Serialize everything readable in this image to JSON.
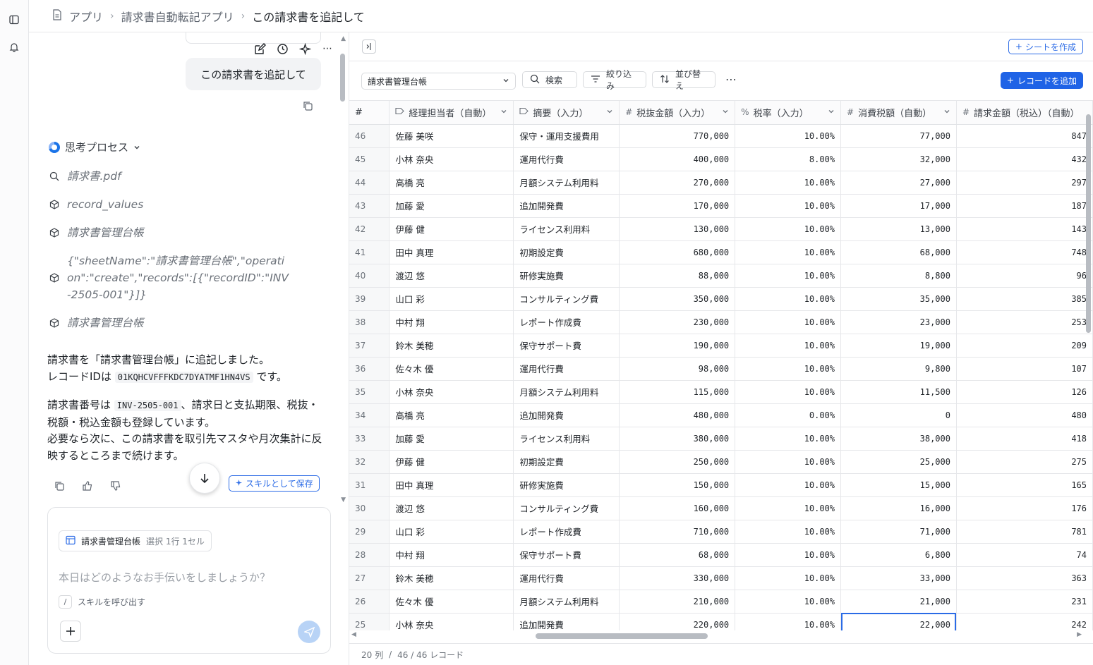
{
  "breadcrumb": {
    "items": [
      "アプリ",
      "請求書自動転記アプリ",
      "この請求書を追記して"
    ]
  },
  "chat": {
    "user_message": "この請求書を追記して",
    "thinking_label": "思考プロセス",
    "steps": [
      {
        "icon": "search-icon",
        "text": "請求書.pdf"
      },
      {
        "icon": "cube-icon",
        "text": "record_values"
      },
      {
        "icon": "cube-icon",
        "text": "請求書管理台帳"
      },
      {
        "icon": "cube-icon",
        "text": "{\"sheetName\":\"請求書管理台帳\",\"operation\":\"create\",\"records\":[{\"recordID\":\"INV-2505-001\"}]}"
      },
      {
        "icon": "cube-icon",
        "text": "請求書管理台帳"
      }
    ],
    "answer": {
      "p1_line1": "請求書を「請求書管理台帳」に追記しました。",
      "p1_prefix": "レコードIDは",
      "record_id": "01KQHCVFFFKDC7DYATMF1HN4VS",
      "p1_suffix": "です。",
      "p2_prefix": "請求書番号は",
      "invoice_no": "INV-2505-001",
      "p2_suffix": "、請求日と支払期限、税抜・税額・税込金額も登録しています。",
      "p3": "必要なら次に、この請求書を取引先マスタや月次集計に反映するところまで続けます。"
    },
    "save_skill_label": "スキルとして保存",
    "composer": {
      "context_sheet": "請求書管理台帳",
      "context_selection": "選択 1行 1セル",
      "placeholder": "本日はどのようなお手伝いをしましょうか？",
      "slash_key": "/",
      "slash_hint": "スキルを呼び出す"
    }
  },
  "sheet": {
    "create_sheet_label": "シートを作成",
    "selected_sheet": "請求書管理台帳",
    "search_label": "検索",
    "filter_label": "絞り込み",
    "sort_label": "並び替え",
    "add_record_label": "レコードを追加",
    "columns": [
      {
        "label": "#",
        "type": ""
      },
      {
        "label": "経理担当者（自動）",
        "type": "tag"
      },
      {
        "label": "摘要（入力）",
        "type": "tag"
      },
      {
        "label": "税抜金額（入力）",
        "type": "#"
      },
      {
        "label": "税率（入力）",
        "type": "%"
      },
      {
        "label": "消費税額（自動）",
        "type": "#"
      },
      {
        "label": "請求金額（税込）（自動）",
        "type": "#"
      }
    ],
    "rows": [
      [
        "46",
        "佐藤 美咲",
        "保守・運用支援費用",
        "770,000",
        "10.00%",
        "77,000",
        "847"
      ],
      [
        "45",
        "小林 奈央",
        "運用代行費",
        "400,000",
        "8.00%",
        "32,000",
        "432"
      ],
      [
        "44",
        "高橋 亮",
        "月額システム利用料",
        "270,000",
        "10.00%",
        "27,000",
        "297"
      ],
      [
        "43",
        "加藤 愛",
        "追加開発費",
        "170,000",
        "10.00%",
        "17,000",
        "187"
      ],
      [
        "42",
        "伊藤 健",
        "ライセンス利用料",
        "130,000",
        "10.00%",
        "13,000",
        "143"
      ],
      [
        "41",
        "田中 真理",
        "初期設定費",
        "680,000",
        "10.00%",
        "68,000",
        "748"
      ],
      [
        "40",
        "渡辺 悠",
        "研修実施費",
        "88,000",
        "10.00%",
        "8,800",
        "96"
      ],
      [
        "39",
        "山口 彩",
        "コンサルティング費",
        "350,000",
        "10.00%",
        "35,000",
        "385"
      ],
      [
        "38",
        "中村 翔",
        "レポート作成費",
        "230,000",
        "10.00%",
        "23,000",
        "253"
      ],
      [
        "37",
        "鈴木 美穂",
        "保守サポート費",
        "190,000",
        "10.00%",
        "19,000",
        "209"
      ],
      [
        "36",
        "佐々木 優",
        "運用代行費",
        "98,000",
        "10.00%",
        "9,800",
        "107"
      ],
      [
        "35",
        "小林 奈央",
        "月額システム利用料",
        "115,000",
        "10.00%",
        "11,500",
        "126"
      ],
      [
        "34",
        "高橋 亮",
        "追加開発費",
        "480,000",
        "0.00%",
        "0",
        "480"
      ],
      [
        "33",
        "加藤 愛",
        "ライセンス利用料",
        "380,000",
        "10.00%",
        "38,000",
        "418"
      ],
      [
        "32",
        "伊藤 健",
        "初期設定費",
        "250,000",
        "10.00%",
        "25,000",
        "275"
      ],
      [
        "31",
        "田中 真理",
        "研修実施費",
        "150,000",
        "10.00%",
        "15,000",
        "165"
      ],
      [
        "30",
        "渡辺 悠",
        "コンサルティング費",
        "160,000",
        "10.00%",
        "16,000",
        "176"
      ],
      [
        "29",
        "山口 彩",
        "レポート作成費",
        "710,000",
        "10.00%",
        "71,000",
        "781"
      ],
      [
        "28",
        "中村 翔",
        "保守サポート費",
        "68,000",
        "10.00%",
        "6,800",
        "74"
      ],
      [
        "27",
        "鈴木 美穂",
        "運用代行費",
        "330,000",
        "10.00%",
        "33,000",
        "363"
      ],
      [
        "26",
        "佐々木 優",
        "月額システム利用料",
        "210,000",
        "10.00%",
        "21,000",
        "231"
      ],
      [
        "25",
        "小林 奈央",
        "追加開発費",
        "220,000",
        "10.00%",
        "22,000",
        "242"
      ]
    ],
    "footer": {
      "column_count": "20 列",
      "separator": "/",
      "record_count": "46 / 46 レコード"
    }
  },
  "colors": {
    "accent": "#2b6be6",
    "primary_button": "#1f63e6"
  }
}
